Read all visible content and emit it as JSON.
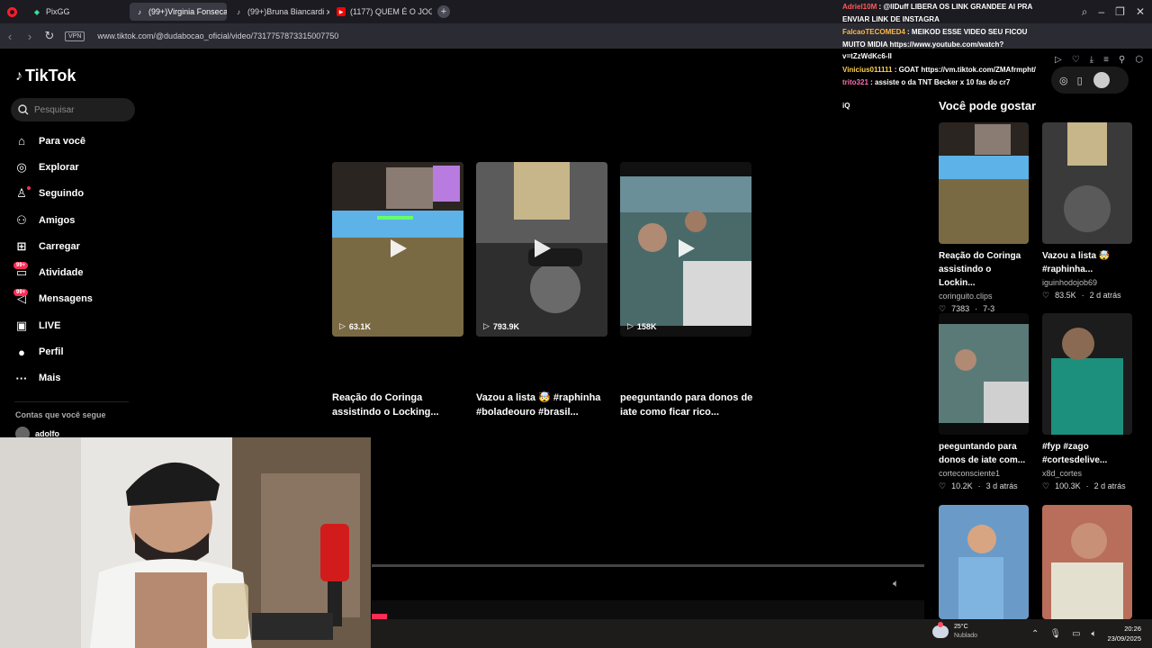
{
  "browser": {
    "tabs": [
      {
        "label": "PixGG",
        "active": false
      },
      {
        "label": "(99+)Virginia Fonseca",
        "active": true
      },
      {
        "label": "(99+)Bruna Biancardi x Vi",
        "active": false
      },
      {
        "label": "(1177) QUEM É O JOGADO",
        "active": false
      }
    ],
    "new_tab": "+",
    "vpn_label": "VPN",
    "url": "www.tiktok.com/@dudabocao_oficial/video/7317757873315007750"
  },
  "tiktok": {
    "logo": "TikTok",
    "search_placeholder": "Pesquisar",
    "menu": [
      {
        "label": "Para você",
        "icon": "home-icon",
        "glyph": "⌂"
      },
      {
        "label": "Explorar",
        "icon": "compass-icon",
        "glyph": "◎"
      },
      {
        "label": "Seguindo",
        "icon": "following-icon",
        "glyph": "♙"
      },
      {
        "label": "Amigos",
        "icon": "friends-icon",
        "glyph": "⚇"
      },
      {
        "label": "Carregar",
        "icon": "upload-icon",
        "glyph": "⊞"
      },
      {
        "label": "Atividade",
        "icon": "activity-icon",
        "glyph": "▭",
        "badge": "99+"
      },
      {
        "label": "Mensagens",
        "icon": "messages-icon",
        "glyph": "◁",
        "badge": "99+"
      },
      {
        "label": "LIVE",
        "icon": "live-icon",
        "glyph": "▣"
      },
      {
        "label": "Perfil",
        "icon": "profile-icon",
        "glyph": "●"
      },
      {
        "label": "Mais",
        "icon": "more-icon",
        "glyph": "···"
      }
    ],
    "following_title": "Contas que você segue",
    "following_user": "adolfo"
  },
  "recommended": [
    {
      "views": "63.1K",
      "title": "Reação do Coringa assistindo o Locking..."
    },
    {
      "views": "793.9K",
      "title": "Vazou a lista 🤯 #raphinha #boladeouro #brasil..."
    },
    {
      "views": "158K",
      "title": "peeguntando para donos de iate como ficar rico..."
    }
  ],
  "right": {
    "heading": "Você pode gostar",
    "cards": [
      {
        "title": "Reação do Coringa assistindo o Lockin...",
        "author": "coringuito.clips",
        "likes": "7383",
        "date": "7-3"
      },
      {
        "title": "Vazou a lista 🤯 #raphinha...",
        "author": "iguinhodojob69",
        "likes": "83.5K",
        "date": "2 d atrás"
      },
      {
        "title": "peeguntando para donos de iate com...",
        "author": "corteconsciente1",
        "likes": "10.2K",
        "date": "3 d atrás"
      },
      {
        "title": "#fyp #zago #cortesdelive...",
        "author": "x8d_cortes",
        "likes": "100.3K",
        "date": "2 d atrás"
      }
    ]
  },
  "chat": [
    {
      "user": "Adriel10M",
      "text": ": @llDuff LIBERA OS LINK GRANDEE AI PRA ENVIAR LINK DE INSTAGRA"
    },
    {
      "user": "FalcaoTECOMED4",
      "text": ": MEIKOD ESSE VIDEO SEU FICOU MUITO MIDIA https://www.youtube.com/watch?v=tZzWdKc6-lI"
    },
    {
      "user": "Vinicius011111",
      "text": ": GOAT https://vm.tiktok.com/ZMAfrmpht/"
    },
    {
      "user": "trito321",
      "text": ": assiste o da TNT Becker x 10 fas do cr7"
    },
    {
      "user": "",
      "text": "iQ"
    }
  ],
  "taskbar": {
    "temperature": "25°C",
    "weather": "Nublado",
    "time": "20:26",
    "date": "23/09/2025"
  },
  "colors": {
    "accent": "#fe2c55",
    "opera": "#ff1b2d"
  }
}
